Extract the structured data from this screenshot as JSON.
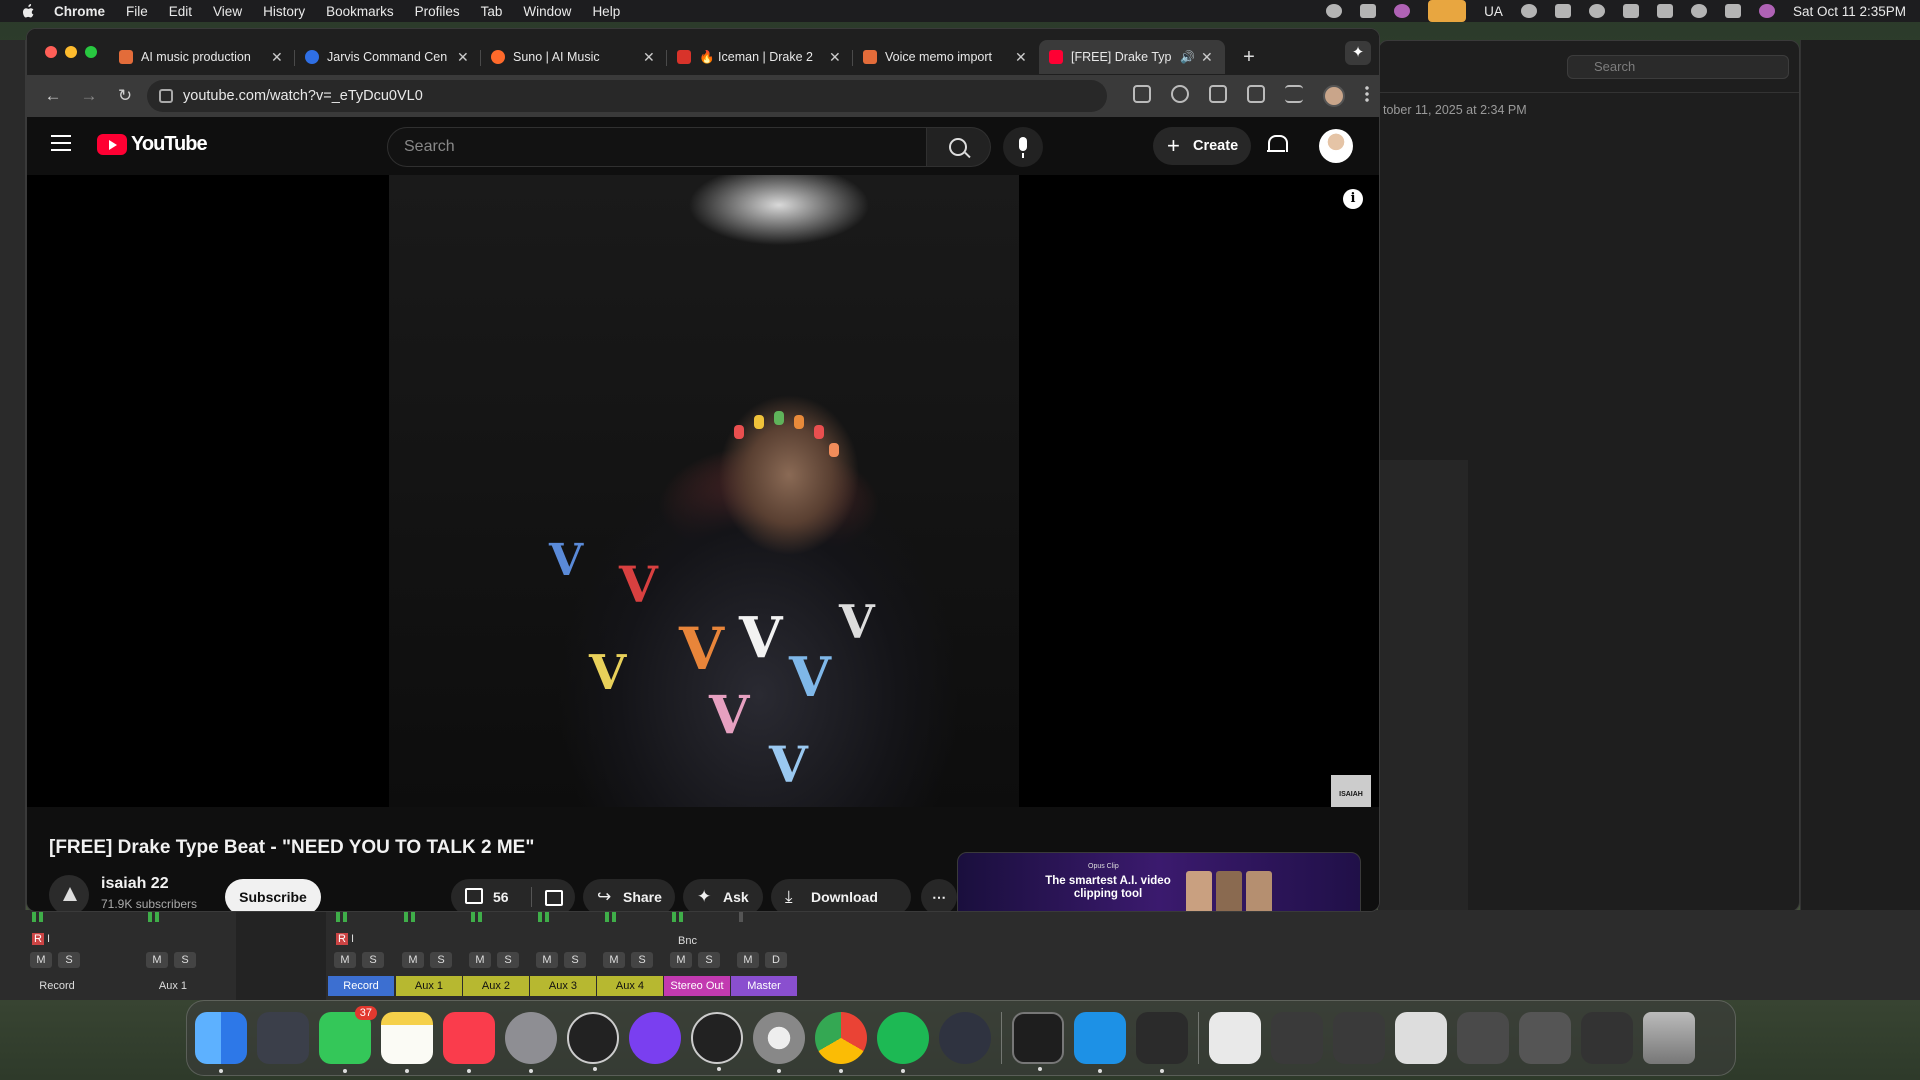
{
  "menubar": {
    "app_name": "Chrome",
    "items": [
      "File",
      "Edit",
      "View",
      "History",
      "Bookmarks",
      "Profiles",
      "Tab",
      "Window",
      "Help"
    ],
    "status_text": "UA",
    "datetime": "Sat Oct 11  2:35PM"
  },
  "chrome": {
    "tabs": [
      {
        "title": "AI music production",
        "favicon_color": "#e36c3a"
      },
      {
        "title": "Jarvis Command Cen",
        "favicon_color": "#2f6fe4"
      },
      {
        "title": "Suno | AI Music",
        "favicon_color": "#ff6a2b"
      },
      {
        "title": "🔥 Iceman | Drake 2",
        "favicon_color": "#d8332a"
      },
      {
        "title": "Voice memo import",
        "favicon_color": "#e36c3a"
      },
      {
        "title": "[FREE] Drake Typ",
        "favicon_color": "#ff0033",
        "active": true
      }
    ],
    "url": "youtube.com/watch?v=_eTyDcu0VL0"
  },
  "youtube": {
    "logo_text": "YouTube",
    "search_placeholder": "Search",
    "create_label": "Create",
    "video_title": "[FREE] Drake Type Beat - \"NEED YOU TO TALK 2 ME\"",
    "channel_name": "isaiah 22",
    "subscribers": "71.9K subscribers",
    "subscribe_label": "Subscribe",
    "like_count": "56",
    "share_label": "Share",
    "ask_label": "Ask",
    "download_label": "Download",
    "watermark_text": "ISAIAH",
    "ad": {
      "brand": "Opus Clip",
      "headline": "The smartest A.I. video clipping tool"
    }
  },
  "notes_window": {
    "search_placeholder": "Search",
    "date_text": "tober 11, 2025 at 2:34 PM"
  },
  "mixer": {
    "left_channels": [
      {
        "name": "Record",
        "buttons": [
          "M",
          "S"
        ]
      },
      {
        "name": "Aux 1",
        "buttons": [
          "M",
          "S"
        ]
      }
    ],
    "channels": [
      {
        "name": "Record",
        "color": "#3c6fd1",
        "buttons": [
          "M",
          "S"
        ]
      },
      {
        "name": "Aux 1",
        "color": "#b7b830",
        "buttons": [
          "M",
          "S"
        ]
      },
      {
        "name": "Aux 2",
        "color": "#b7b830",
        "buttons": [
          "M",
          "S"
        ]
      },
      {
        "name": "Aux 3",
        "color": "#b7b830",
        "buttons": [
          "M",
          "S"
        ]
      },
      {
        "name": "Aux 4",
        "color": "#b7b830",
        "buttons": [
          "M",
          "S"
        ]
      },
      {
        "name": "Stereo Out",
        "color": "#c23ab0",
        "buttons": [
          "M",
          "S"
        ],
        "extra": "Bnc"
      },
      {
        "name": "Master",
        "color": "#8a4fcf",
        "buttons": [
          "M",
          "D"
        ]
      }
    ],
    "record_flags": [
      "R",
      "I"
    ]
  },
  "dock": {
    "messages_badge": "37",
    "apps": [
      "Finder",
      "Launchpad",
      "Messages",
      "Notes",
      "Music",
      "System Settings",
      "Logic",
      "Arc",
      "Audio MIDI",
      "Disk Utility",
      "Chrome",
      "Spotify",
      "Atom",
      "Terminal",
      "Docker",
      "Audio"
    ]
  }
}
